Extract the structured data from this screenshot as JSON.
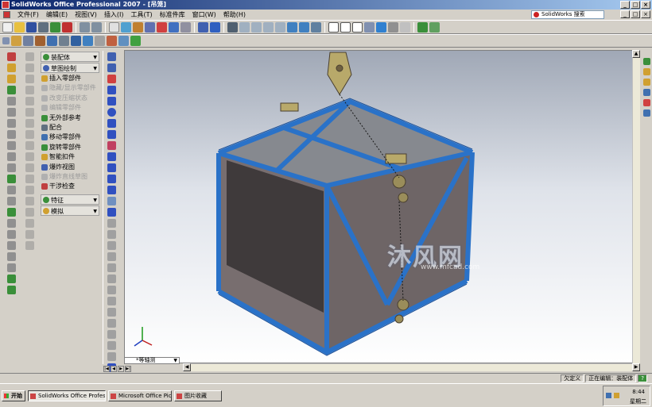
{
  "window": {
    "title": "SolidWorks Office Professional 2007 - [吊笼]"
  },
  "menu": {
    "items": [
      "文件(F)",
      "编辑(E)",
      "视图(V)",
      "插入(I)",
      "工具(T)",
      "标准件库",
      "窗口(W)",
      "帮助(H)"
    ]
  },
  "search": {
    "placeholder": "SolidWorks 搜索"
  },
  "command_manager": {
    "groups": [
      {
        "label": "装配体"
      },
      {
        "label": "草图绘制"
      }
    ],
    "items": [
      {
        "label": "插入零部件",
        "enabled": true
      },
      {
        "label": "隐藏/显示零部件",
        "enabled": false
      },
      {
        "label": "改变压缩状态",
        "enabled": false
      },
      {
        "label": "编辑零部件",
        "enabled": false
      },
      {
        "label": "无外部参考",
        "enabled": true
      },
      {
        "label": "配合",
        "enabled": true
      },
      {
        "label": "移动零部件",
        "enabled": true
      },
      {
        "label": "旋转零部件",
        "enabled": true
      },
      {
        "label": "智能扣件",
        "enabled": true
      },
      {
        "label": "爆炸视图",
        "enabled": true
      },
      {
        "label": "爆炸直线草图",
        "enabled": false
      },
      {
        "label": "干涉检查",
        "enabled": true
      }
    ],
    "bottom_groups": [
      {
        "label": "特征"
      },
      {
        "label": "模拟"
      }
    ]
  },
  "viewport": {
    "view_tab": "*等轴测",
    "watermark": {
      "brand": "沐风网",
      "url": "www.mfcad.com"
    }
  },
  "status": {
    "state": "欠定义",
    "editing": "正在编辑：装配体",
    "help": "?"
  },
  "taskbar": {
    "start": "开始",
    "tasks": [
      {
        "label": "SolidWorks Office Profes...",
        "active": true
      },
      {
        "label": "Microsoft Office Picture ...",
        "active": false
      },
      {
        "label": "图片收藏",
        "active": false
      }
    ],
    "clock": "8:44",
    "weekday": "星期二"
  },
  "colors": {
    "frame": "#2a72c8",
    "panel": "#6e6566",
    "viewport_top": "#a0a8b6"
  }
}
